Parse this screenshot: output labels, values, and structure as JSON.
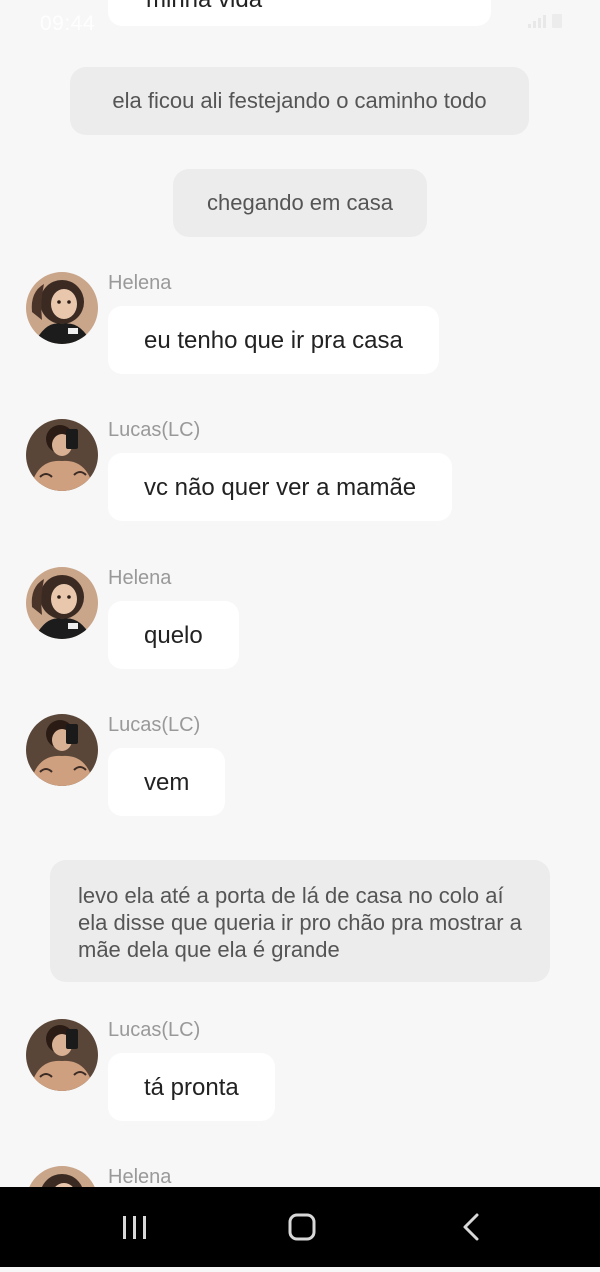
{
  "status_bar": {
    "time": "09:44"
  },
  "top_message": {
    "text": "minha vida"
  },
  "narrations": [
    "ela ficou ali festejando o caminho todo",
    "chegando em casa",
    "levo ela até a porta de lá de casa no colo aí ela disse que queria ir pro chão pra mostrar a mãe dela que ela é grande"
  ],
  "messages": [
    {
      "sender": "Helena",
      "text": "eu tenho que ir pra casa"
    },
    {
      "sender": "Lucas(LC)",
      "text": "vc não quer ver a mamãe"
    },
    {
      "sender": "Helena",
      "text": "quelo"
    },
    {
      "sender": "Lucas(LC)",
      "text": "vem"
    },
    {
      "sender": "Lucas(LC)",
      "text": "tá pronta"
    },
    {
      "sender": "Helena",
      "text": ""
    }
  ],
  "nav_bar": {
    "icons": [
      "recent-apps-icon",
      "home-icon",
      "back-icon"
    ]
  }
}
